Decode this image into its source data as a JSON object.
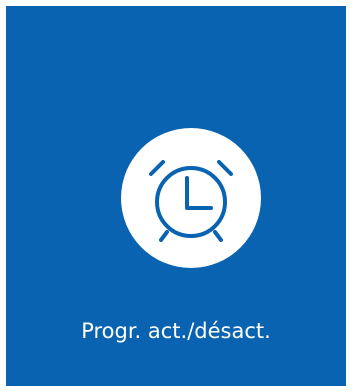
{
  "tile": {
    "label": "Progr. act./désact.",
    "icon": "alarm-clock-icon",
    "background_color": "#0a63b0",
    "icon_circle_color": "#ffffff",
    "icon_color": "#0a63b0"
  }
}
